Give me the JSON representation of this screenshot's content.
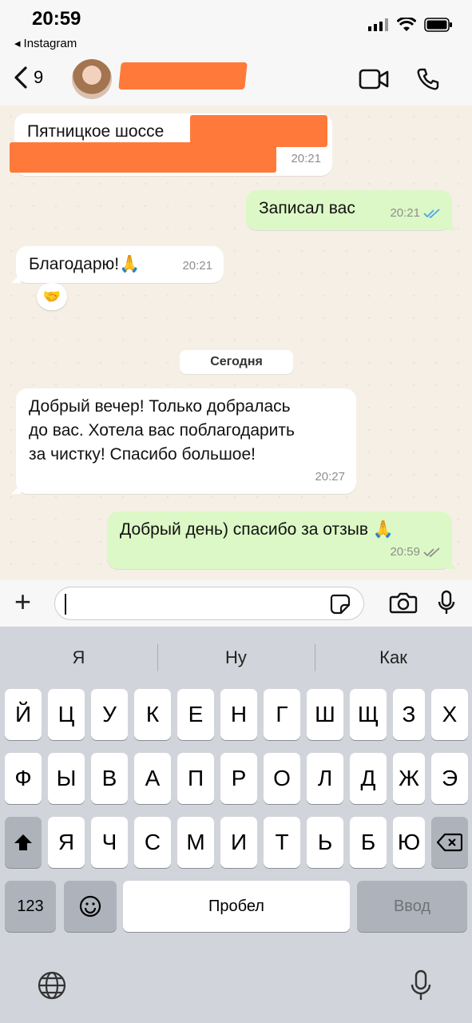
{
  "status_bar": {
    "time": "20:59",
    "back_app": "Instagram"
  },
  "header": {
    "back_count": "9"
  },
  "messages": {
    "m1_text": "Пятницкое шоссе",
    "m1_time": "20:21",
    "m2_text": "Записал вас",
    "m2_time": "20:21",
    "m3_text": "Благодарю!🙏",
    "m3_time": "20:21",
    "m3_reaction": "🤝",
    "date_chip": "Сегодня",
    "m4_line1": "Добрый вечер! Только добралась",
    "m4_line2": "до вас. Хотела вас поблагодарить",
    "m4_line3": "за чистку! Спасибо большое!",
    "m4_time": "20:27",
    "m5_text": "Добрый день) спасибо за отзыв 🙏",
    "m5_time": "20:59"
  },
  "input": {
    "value": ""
  },
  "keyboard": {
    "suggestions": [
      "Я",
      "Ну",
      "Как"
    ],
    "row1": [
      "Й",
      "Ц",
      "У",
      "К",
      "Е",
      "Н",
      "Г",
      "Ш",
      "Щ",
      "З",
      "Х"
    ],
    "row2": [
      "Ф",
      "Ы",
      "В",
      "А",
      "П",
      "Р",
      "О",
      "Л",
      "Д",
      "Ж",
      "Э"
    ],
    "row3": [
      "Я",
      "Ч",
      "С",
      "М",
      "И",
      "Т",
      "Ь",
      "Б",
      "Ю"
    ],
    "numbers_label": "123",
    "space_label": "Пробел",
    "return_label": "Ввод"
  },
  "icons": {
    "back_icon": "chevron-left",
    "video_icon": "video-camera",
    "call_icon": "phone",
    "plus_icon": "plus",
    "sticker_icon": "sticker",
    "camera_icon": "camera",
    "mic_icon": "microphone",
    "emoji_icon": "smiley",
    "globe_icon": "globe",
    "shift_icon": "shift-up-arrow",
    "delete_icon": "backspace"
  },
  "colors": {
    "outgoing_bubble": "#dcf8c6",
    "incoming_bubble": "#ffffff",
    "chat_background": "#f5efe6",
    "tick_blue": "#4fa3e6",
    "redaction": "#ff7a3a"
  }
}
